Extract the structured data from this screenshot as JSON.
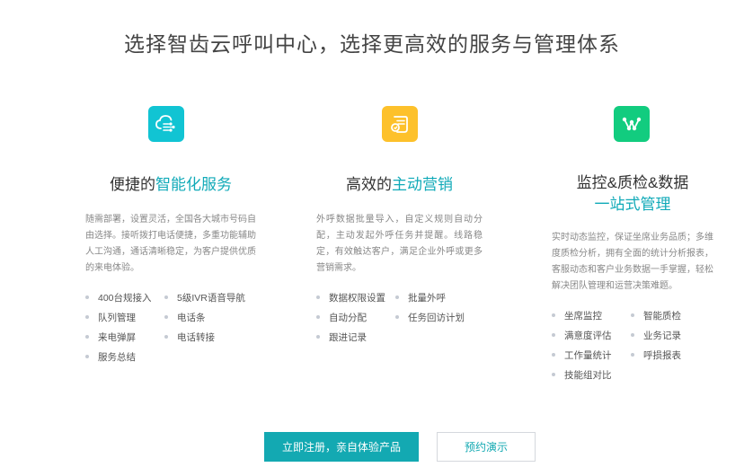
{
  "headline": "选择智齿云呼叫中心，选择更高效的服务与管理体系",
  "columns": [
    {
      "icon": "cloud-connect-icon",
      "icon_color": "#11c4d3",
      "title_plain": "便捷的",
      "title_highlight": "智能化服务",
      "description": "随需部署，设置灵活，全国各大城市号码自由选择。接听拨打电话便捷，多重功能辅助人工沟通，通话清晰稳定，为客户提供优质的来电体验。",
      "features": [
        "400台规接入",
        "5级IVR语音导航",
        "队列管理",
        "电话条",
        "来电弹屏",
        "电话转接",
        "服务总结"
      ]
    },
    {
      "icon": "document-list-icon",
      "icon_color": "#fdc12b",
      "title_plain": "高效的",
      "title_highlight": "主动营销",
      "description": "外呼数据批量导入，自定义规则自动分配，主动发起外呼任务并提醒。线路稳定，有效触达客户，满足企业外呼或更多营销需求。",
      "features": [
        "数据权限设置",
        "批量外呼",
        "自动分配",
        "任务回访计划",
        "跟进记录"
      ]
    },
    {
      "icon": "monitor-graph-icon",
      "icon_color": "#12cc7f",
      "title_plain": "监控&质检&数据",
      "title_highlight": "一站式管理",
      "description": "实时动态监控，保证坐席业务品质；多维度质检分析，拥有全面的统计分析报表，客服动态和客户业务数据一手掌握，轻松解决团队管理和运营决策难题。",
      "features": [
        "坐席监控",
        "智能质检",
        "满意度评估",
        "业务记录",
        "工作量统计",
        "呼损报表",
        "技能组对比"
      ]
    }
  ],
  "cta": {
    "primary": "立即注册，亲自体验产品",
    "secondary": "预约演示"
  }
}
